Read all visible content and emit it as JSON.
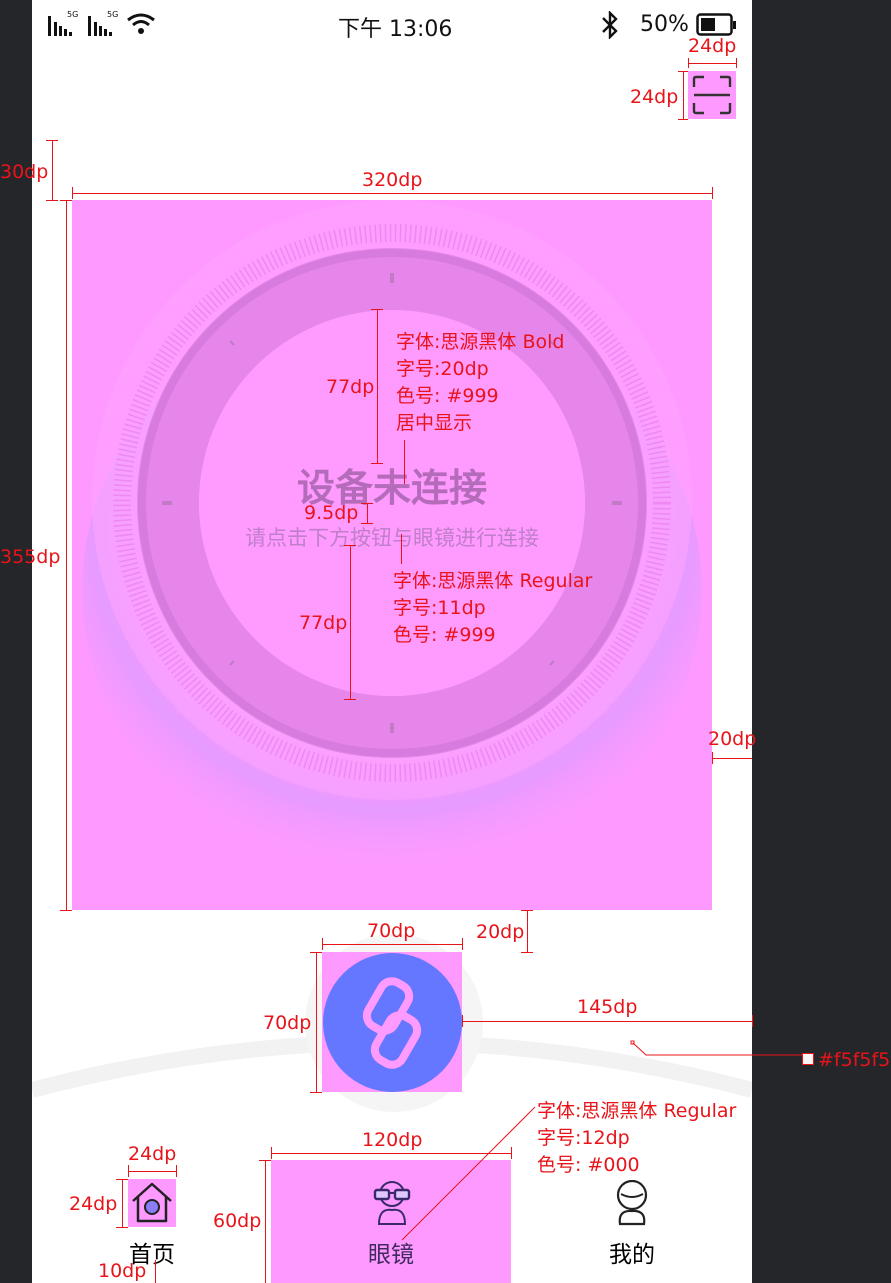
{
  "status_bar": {
    "signal1": "5G",
    "signal2": "5G",
    "time": "下午 13:06",
    "battery": "50%"
  },
  "main": {
    "title": "设备未连接",
    "subtitle": "请点击下方按钮与眼镜进行连接"
  },
  "nav": {
    "items": [
      {
        "label": "首页",
        "icon": "home-icon"
      },
      {
        "label": "眼镜",
        "icon": "glasses-icon"
      },
      {
        "label": "我的",
        "icon": "user-icon"
      }
    ]
  },
  "annotations": {
    "scan_w": "24dp",
    "scan_h": "24dp",
    "top_margin": "30dp",
    "panel_width": "320dp",
    "panel_height": "355dp",
    "side_margin": "20dp",
    "gap_bottom": "20dp",
    "title_top": "77dp",
    "title_gap": "9.5dp",
    "sub_bottom": "77dp",
    "title_font": "字体:思源黑体 Bold",
    "title_size": "字号:20dp",
    "title_color": "色号: #999",
    "title_align": "居中显示",
    "sub_font": "字体:思源黑体 Regular",
    "sub_size": "字号:11dp",
    "sub_color": "色号: #999",
    "btn_w": "70dp",
    "btn_h": "70dp",
    "arc_right": "145dp",
    "arc_color": "#f5f5f5",
    "nav_font": "字体:思源黑体 Regular",
    "nav_size": "字号:12dp",
    "nav_color": "色号: #000",
    "tab_w": "120dp",
    "tab_h": "60dp",
    "home_w": "24dp",
    "home_h": "24dp",
    "label_gap": "10dp"
  },
  "colors": {
    "highlight": "#fe9aff",
    "button": "#6677ff",
    "annotation": "#e8141a",
    "arc": "#f5f5f5"
  }
}
